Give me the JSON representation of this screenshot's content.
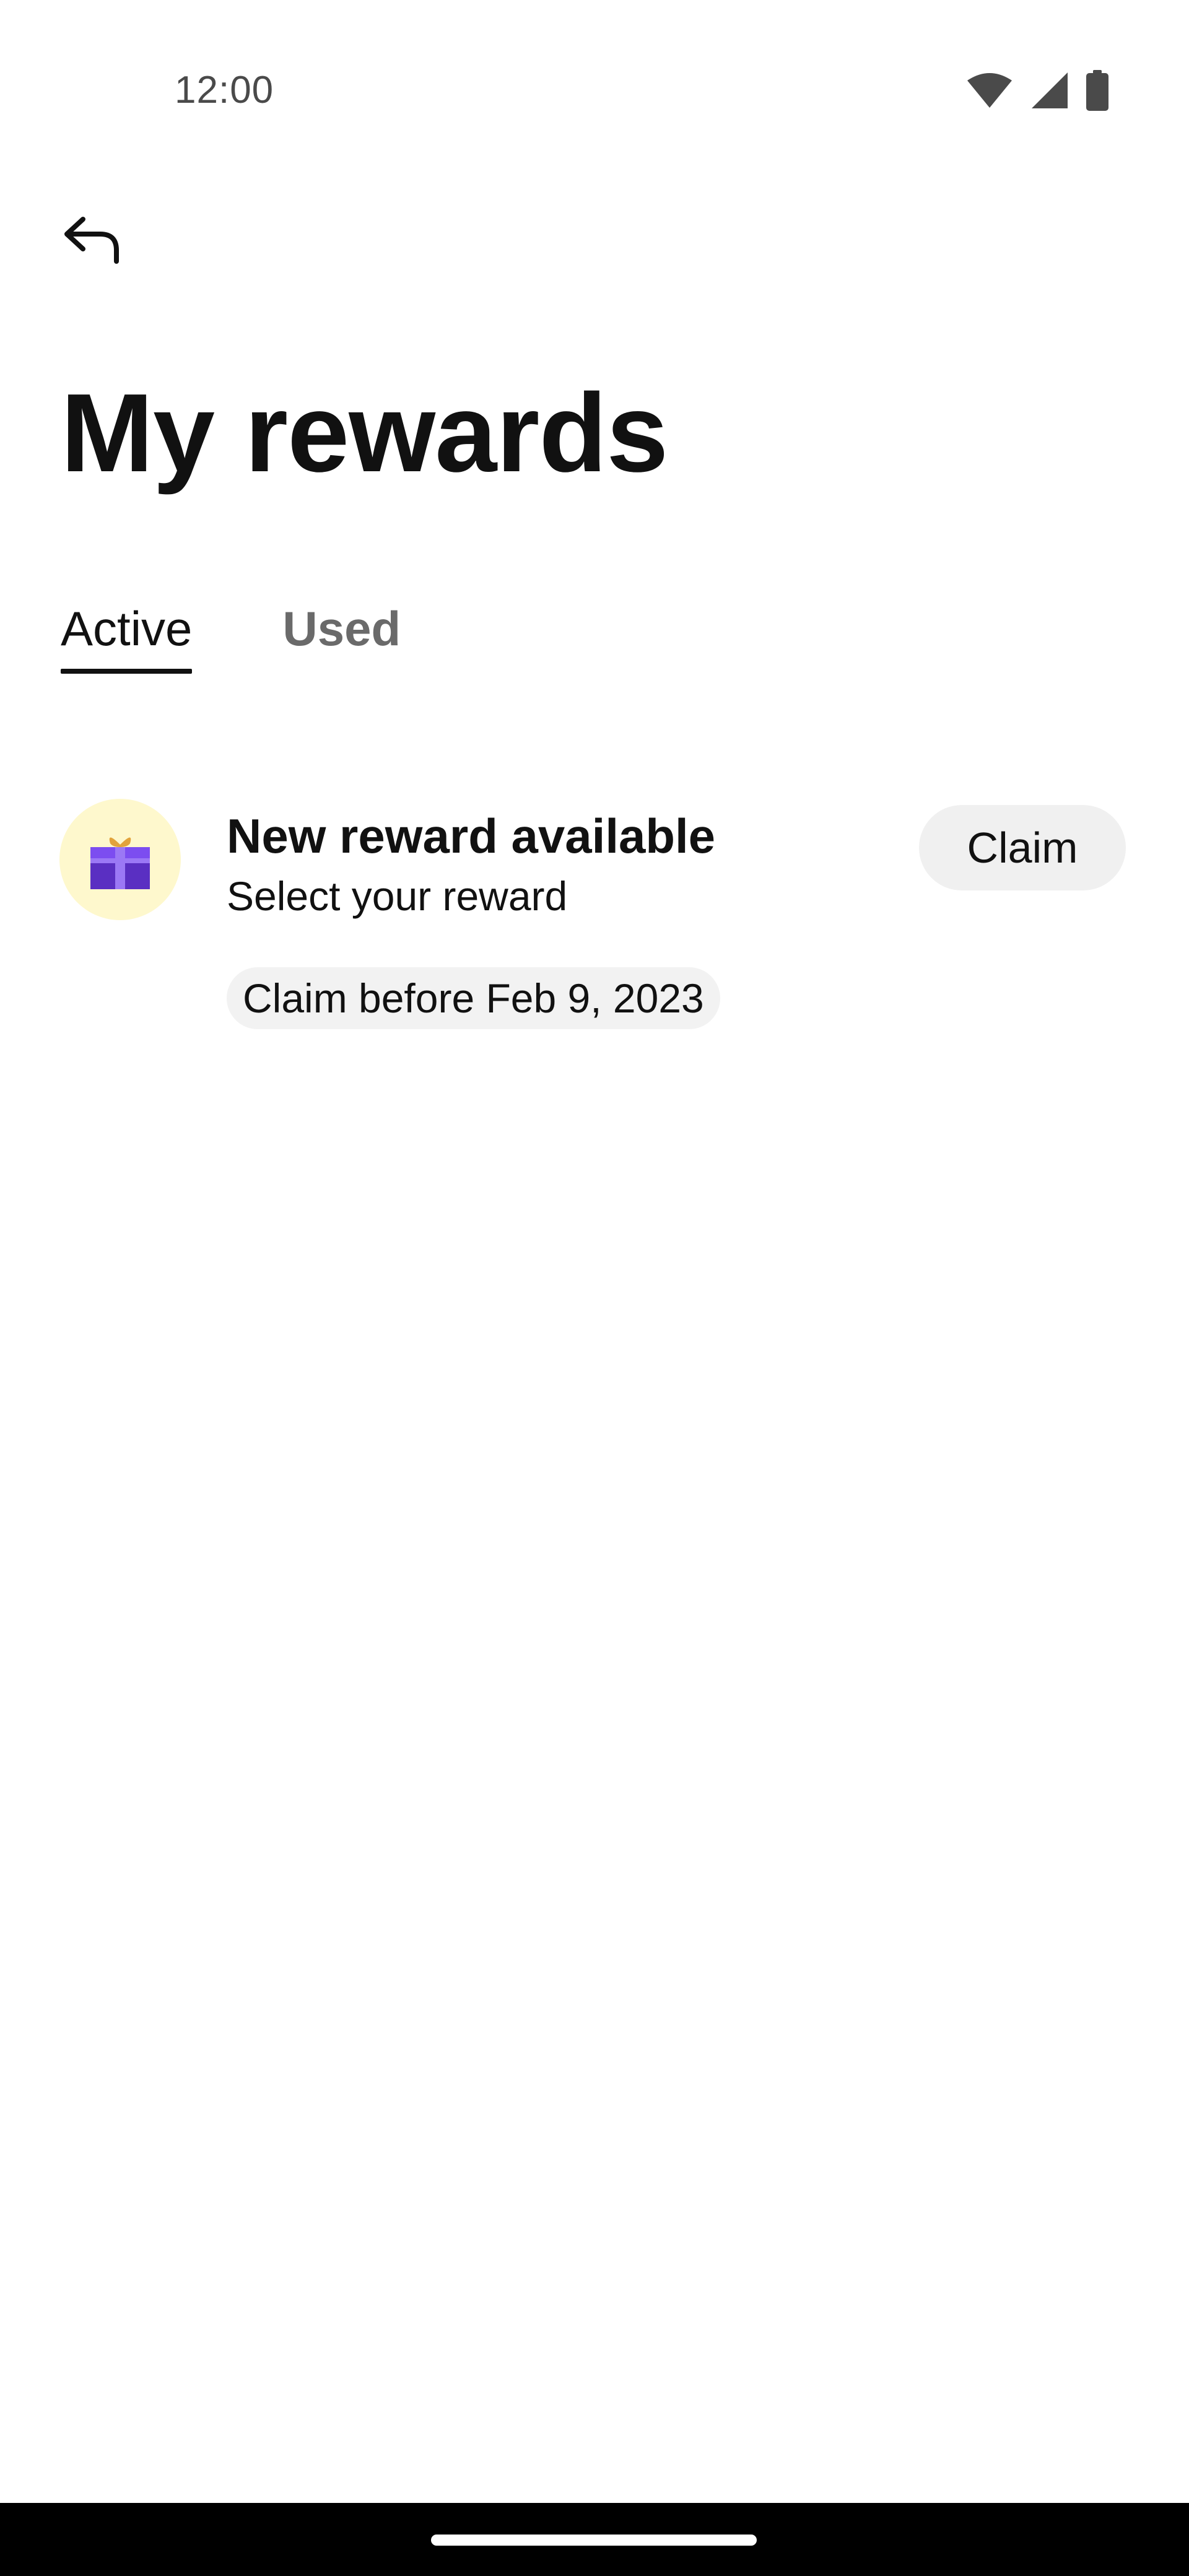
{
  "status_bar": {
    "time": "12:00",
    "icons": [
      "wifi-icon",
      "cellular-signal-icon",
      "battery-icon"
    ]
  },
  "header": {
    "back_icon": "back-arrow-icon",
    "title": "My rewards"
  },
  "tabs": [
    {
      "label": "Active",
      "selected": true
    },
    {
      "label": "Used",
      "selected": false
    }
  ],
  "rewards": [
    {
      "icon": "gift-icon",
      "title": "New reward available",
      "subtitle": "Select your reward",
      "deadline": "Claim before Feb 9, 2023",
      "action_label": "Claim"
    }
  ],
  "colors": {
    "icon_background": "#fef8cd",
    "gift_purple": "#6a3bd9",
    "gift_bow": "#e2a33c",
    "claim_button_bg": "#f0f0f0",
    "chip_bg": "#f2f2f2"
  }
}
